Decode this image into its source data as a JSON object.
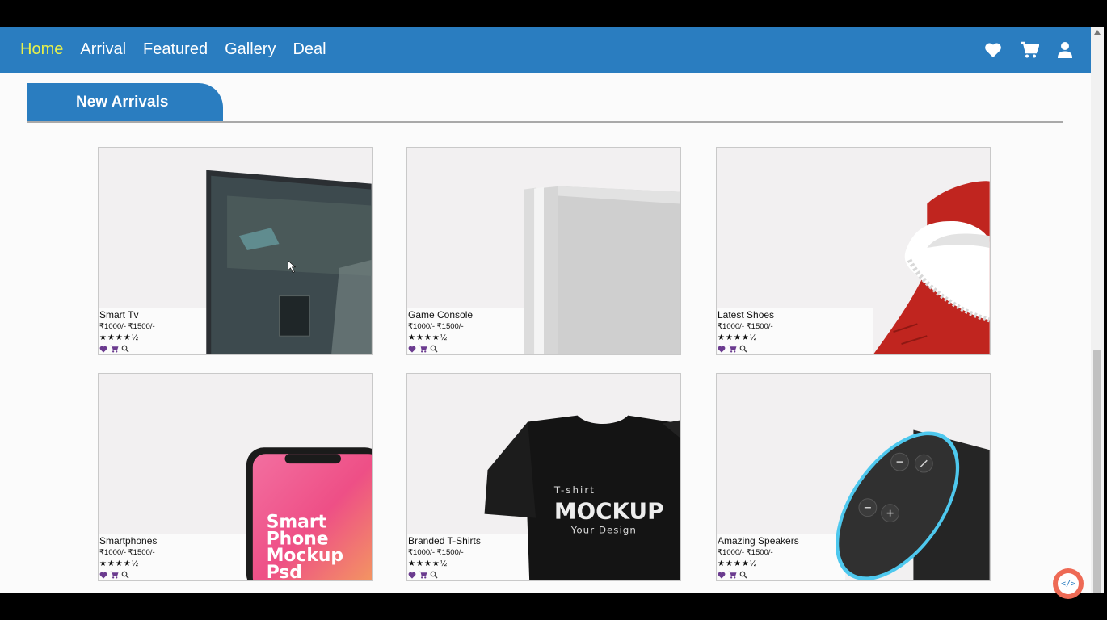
{
  "nav": {
    "links": [
      "Home",
      "Arrival",
      "Featured",
      "Gallery",
      "Deal"
    ],
    "active": "Home",
    "icons": [
      "heart-icon",
      "cart-icon",
      "user-icon"
    ]
  },
  "section": {
    "title": "New Arrivals"
  },
  "products": [
    {
      "name": "Smart Tv",
      "price": "₹1000/- ₹1500/-",
      "rating": 4.5,
      "stars": "★★★★½"
    },
    {
      "name": "Game Console",
      "price": "₹1000/- ₹1500/-",
      "rating": 4.5,
      "stars": "★★★★½"
    },
    {
      "name": "Latest Shoes",
      "price": "₹1000/- ₹1500/-",
      "rating": 4.5,
      "stars": "★★★★½"
    },
    {
      "name": "Smartphones",
      "price": "₹1000/- ₹1500/-",
      "rating": 4.5,
      "stars": "★★★★½"
    },
    {
      "name": "Branded T-Shirts",
      "price": "₹1000/- ₹1500/-",
      "rating": 4.5,
      "stars": "★★★★½"
    },
    {
      "name": "Amazing Speakers",
      "price": "₹1000/- ₹1500/-",
      "rating": 4.5,
      "stars": "★★★★½"
    }
  ],
  "artwork_text": {
    "phone": [
      "Smart",
      "Phone",
      "Mockup",
      "Psd"
    ],
    "tshirt": [
      "T-shirt",
      "MOCKUP",
      "Your Design"
    ]
  },
  "badge": {
    "label": "</>"
  },
  "colors": {
    "brand_blue": "#2a7dc0",
    "active_link": "#e8f04a",
    "action_purple": "#6b3b8f"
  }
}
